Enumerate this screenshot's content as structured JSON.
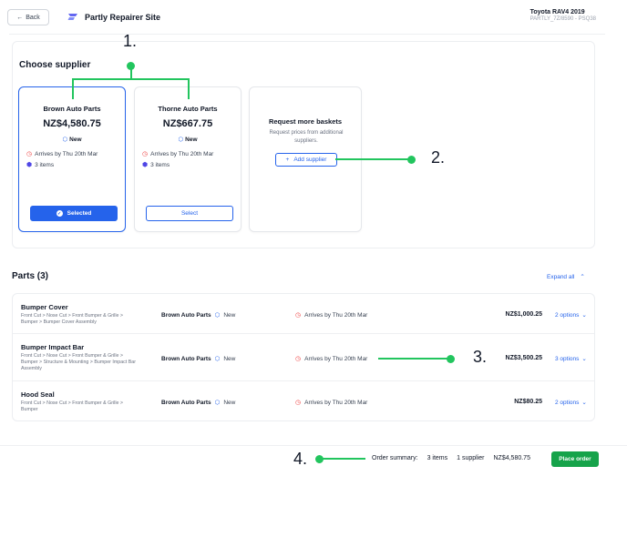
{
  "header": {
    "back_label": "Back",
    "back_icon": "←",
    "site_name": "Partly Repairer Site",
    "vehicle_name": "Toyota RAV4 2019",
    "vehicle_code": "PARTLY_7Z/8590 - PSQ38",
    "logo_color": "#6366f1"
  },
  "supplier_section": {
    "title": "Choose supplier",
    "cards": [
      {
        "name": "Brown Auto Parts",
        "price": "NZ$4,580.75",
        "condition": "New",
        "arrival": "Arrives by Thu 20th Mar",
        "items": "3 items",
        "button_label": "Selected",
        "selected": true
      },
      {
        "name": "Thorne Auto Parts",
        "price": "NZ$667.75",
        "condition": "New",
        "arrival": "Arrives by Thu 20th Mar",
        "items": "3 items",
        "button_label": "Select",
        "selected": false
      }
    ],
    "request": {
      "title": "Request more baskets",
      "description": "Request prices from additional suppliers.",
      "button_label": "Add supplier",
      "button_icon": "+"
    }
  },
  "annotations": [
    "1.",
    "2.",
    "3.",
    "4."
  ],
  "annotation_color": "#22c55e",
  "parts": {
    "title": "Parts (3)",
    "expand_label": "Expand all",
    "rows": [
      {
        "name": "Bumper Cover",
        "path": "Front Cut > Nose Cut > Front Bumper & Grille > Bumper > Bumper Cover Assembly",
        "supplier": "Brown Auto Parts",
        "condition": "New",
        "arrival": "Arrives by Thu 20th Mar",
        "price": "NZ$1,000.25",
        "options": "2 options"
      },
      {
        "name": "Bumper Impact Bar",
        "path": "Front Cut > Nose Cut > Front Bumper & Grille > Bumper > Structure & Mounting > Bumper Impact Bar Assembly",
        "supplier": "Brown Auto Parts",
        "condition": "New",
        "arrival": "Arrives by Thu 20th Mar",
        "price": "NZ$3,500.25",
        "options": "3 options"
      },
      {
        "name": "Hood Seal",
        "path": "Front Cut > Nose Cut > Front Bumper & Grille > Bumper",
        "supplier": "Brown Auto Parts",
        "condition": "New",
        "arrival": "Arrives by Thu 20th Mar",
        "price": "NZ$80.25",
        "options": "2 options"
      }
    ]
  },
  "footer": {
    "summary_label": "Order summary:",
    "items": "3 items",
    "suppliers": "1 supplier",
    "total": "NZ$4,580.75",
    "place_order_label": "Place order"
  },
  "colors": {
    "primary": "#2563eb",
    "success": "#16a34a",
    "warning_clock": "#ef4444"
  }
}
